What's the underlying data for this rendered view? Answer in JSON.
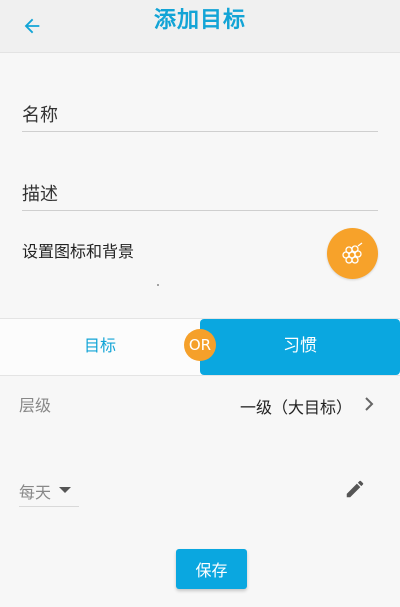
{
  "header": {
    "title": "添加目标",
    "back_icon": "arrow-left-icon"
  },
  "form": {
    "name_label": "名称",
    "description_label": "描述",
    "icon_bg_label": "设置图标和背景",
    "icon_name": "grapes-icon",
    "icon_bg_color": "#f7a22a"
  },
  "type_toggle": {
    "option_goal": "目标",
    "option_habit": "习惯",
    "or_label": "OR",
    "selected": "习惯"
  },
  "level": {
    "label": "层级",
    "value": "一级（大目标）"
  },
  "frequency": {
    "selected": "每天"
  },
  "actions": {
    "save_label": "保存"
  },
  "colors": {
    "accent": "#0aa7e0",
    "title": "#12a4d6",
    "orange": "#f5a02a"
  }
}
